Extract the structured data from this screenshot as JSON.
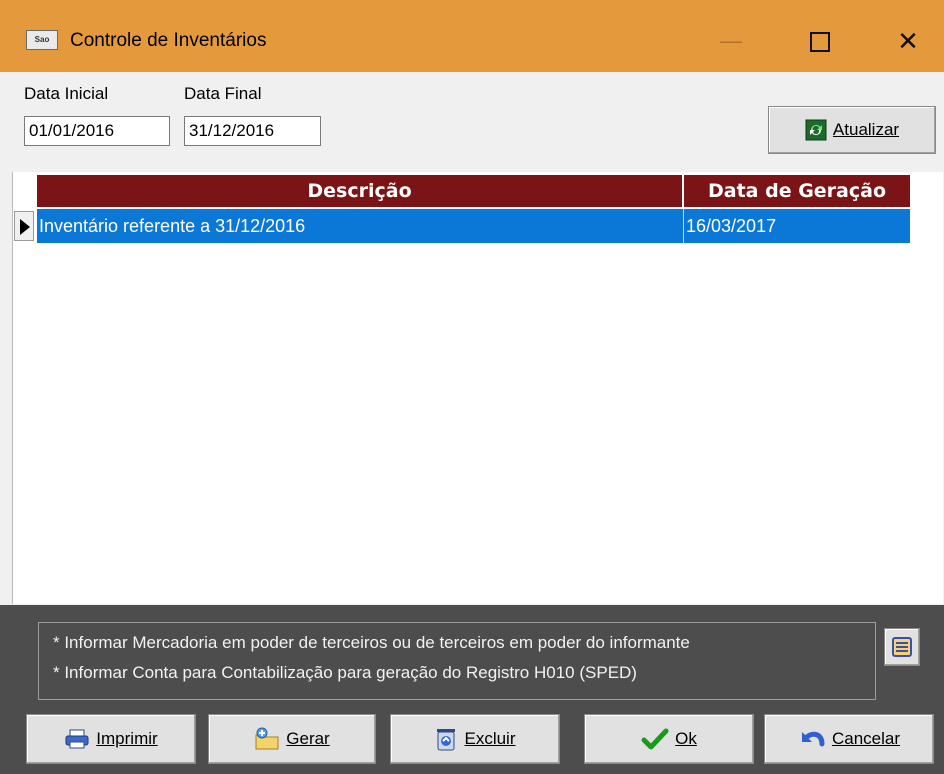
{
  "window": {
    "title": "Controle de Inventários",
    "app_icon_text": "Sao",
    "minimize": "—",
    "close": "✕"
  },
  "filters": {
    "start_label": "Data Inicial",
    "start_value": "01/01/2016",
    "end_label": "Data Final",
    "end_value": "31/12/2016",
    "refresh_label": "Atualizar"
  },
  "table": {
    "headers": [
      "Descrição",
      "Data de Geração"
    ],
    "rows": [
      {
        "descricao": "Inventário referente a 31/12/2016",
        "data_geracao": "16/03/2017"
      }
    ]
  },
  "info": {
    "line1": "* Informar Mercadoria em poder de terceiros ou de terceiros em poder do informante",
    "line2": "* Informar Conta para Contabilização para geração do Registro H010 (SPED)"
  },
  "buttons": {
    "print": "Imprimir",
    "generate": "Gerar",
    "delete": "Excluir",
    "ok": "Ok",
    "cancel": "Cancelar"
  },
  "colors": {
    "titlebar": "#e49a3c",
    "header": "#7b1416",
    "selected_row": "#0b78d7",
    "bottom_panel": "#4d4d4d"
  }
}
